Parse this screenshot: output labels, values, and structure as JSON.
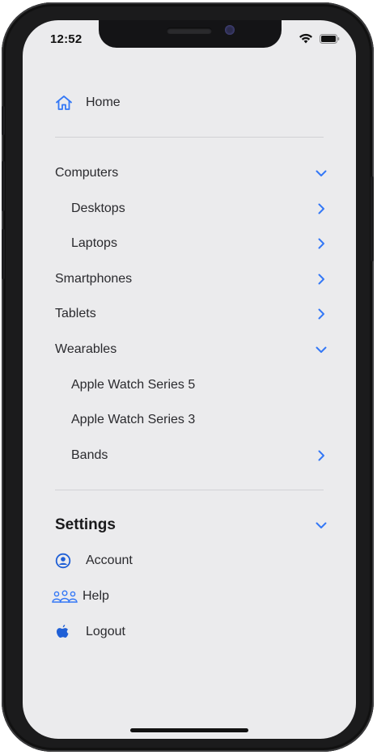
{
  "status": {
    "time": "12:52"
  },
  "home": {
    "label": "Home"
  },
  "categories": [
    {
      "label": "Computers",
      "chevron": "chevron-down-icon",
      "indent": false
    },
    {
      "label": "Desktops",
      "chevron": "chevron-right-icon",
      "indent": true
    },
    {
      "label": "Laptops",
      "chevron": "chevron-right-icon",
      "indent": true
    },
    {
      "label": "Smartphones",
      "chevron": "chevron-right-icon",
      "indent": false
    },
    {
      "label": "Tablets",
      "chevron": "chevron-right-icon",
      "indent": false
    },
    {
      "label": "Wearables",
      "chevron": "chevron-down-icon",
      "indent": false
    },
    {
      "label": "Apple Watch Series 5",
      "chevron": "",
      "indent": true
    },
    {
      "label": "Apple Watch Series 3",
      "chevron": "",
      "indent": true
    },
    {
      "label": "Bands",
      "chevron": "chevron-right-icon",
      "indent": true
    }
  ],
  "settings": {
    "title": "Settings",
    "items": [
      {
        "label": "Account",
        "icon": "user-circle-icon"
      },
      {
        "label": "Help",
        "icon": "people-icon"
      },
      {
        "label": "Logout",
        "icon": "apple-icon"
      }
    ]
  },
  "colors": {
    "accent": "#3478f6",
    "background": "#ebebed",
    "text": "#2a2a2e"
  }
}
